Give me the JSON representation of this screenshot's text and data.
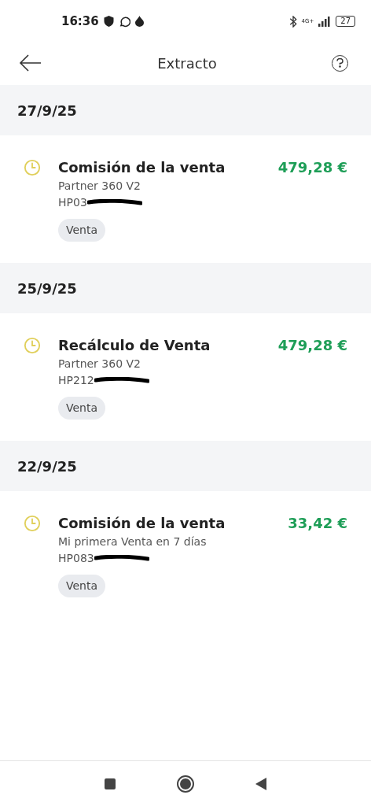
{
  "status_bar": {
    "time": "16:36",
    "network": "4G+",
    "battery": "27"
  },
  "header": {
    "title": "Extracto"
  },
  "sections": [
    {
      "date": "27/9/25",
      "items": [
        {
          "title": "Comisión de la venta",
          "product": "Partner 360 V2",
          "reference": "HP03",
          "amount": "479,28 €",
          "tag": "Venta"
        }
      ]
    },
    {
      "date": "25/9/25",
      "items": [
        {
          "title": "Recálculo de Venta",
          "product": "Partner 360 V2",
          "reference": "HP212",
          "amount": "479,28 €",
          "tag": "Venta"
        }
      ]
    },
    {
      "date": "22/9/25",
      "items": [
        {
          "title": "Comisión de la venta",
          "product": "Mi primera Venta en 7 días",
          "reference": "HP083",
          "amount": "33,42 €",
          "tag": "Venta"
        }
      ]
    }
  ]
}
